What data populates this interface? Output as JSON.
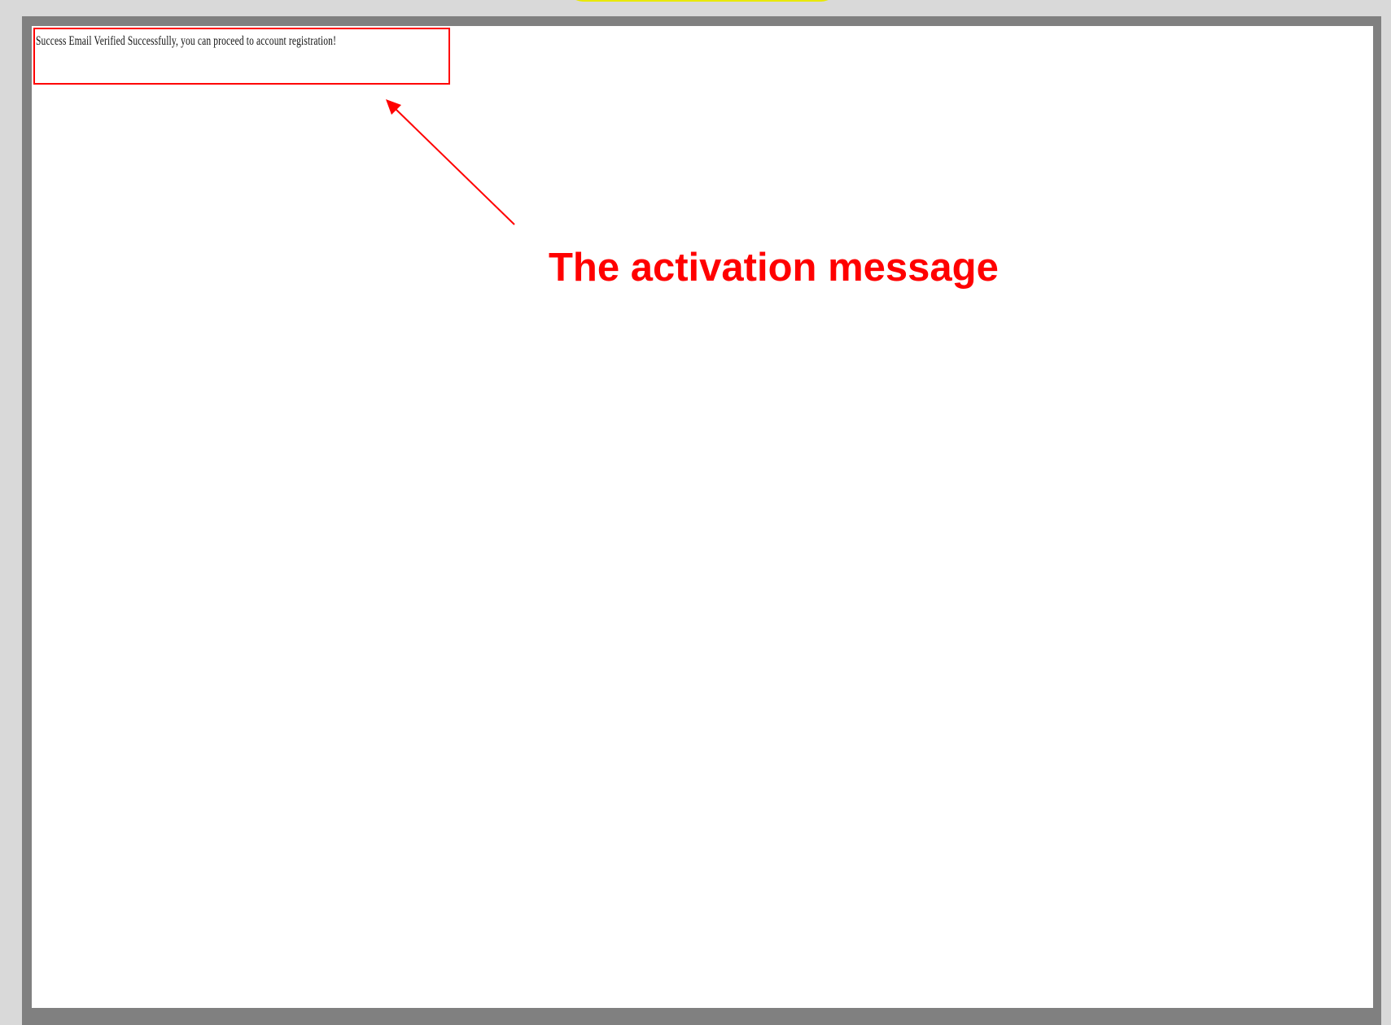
{
  "browser": {
    "page_message": "Success  Email Verified Successfully, you can proceed to account registration!"
  },
  "annotation": {
    "label": "The activation message",
    "color": "#ff0000"
  }
}
